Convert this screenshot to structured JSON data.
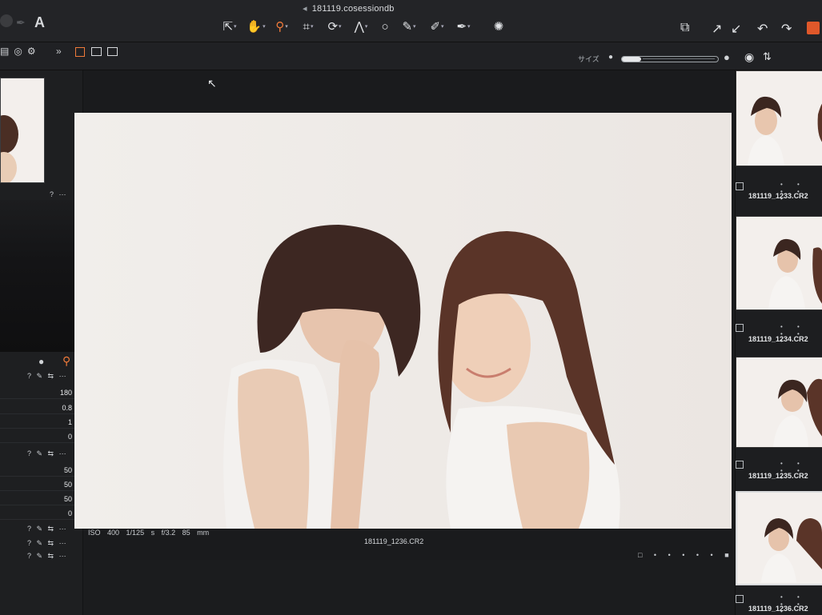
{
  "window": {
    "title": "181119.cosessiondb"
  },
  "toolbar": {
    "tools": [
      {
        "icon": "select-arrow-icon",
        "glyph": "⇱"
      },
      {
        "icon": "pan-hand-icon",
        "glyph": "✋"
      },
      {
        "icon": "zoom-icon",
        "glyph": "⚲",
        "active": true
      },
      {
        "icon": "crop-icon",
        "glyph": "⌗"
      },
      {
        "icon": "rotate-icon",
        "glyph": "⟳"
      },
      {
        "icon": "keystone-icon",
        "glyph": "⋀"
      },
      {
        "icon": "spot-circle-icon",
        "glyph": "○"
      },
      {
        "icon": "brush-icon",
        "glyph": "✎"
      },
      {
        "icon": "eraser-icon",
        "glyph": "✐"
      },
      {
        "icon": "picker-icon",
        "glyph": "✒"
      },
      {
        "icon": "spinner-icon",
        "glyph": "✺"
      }
    ],
    "right_tools": [
      "window-stack-icon",
      "export-arrow-icon",
      "import-arrow-icon",
      "undo-icon",
      "redo-icon"
    ]
  },
  "left_header": {
    "app_letter": "A"
  },
  "browser": {
    "size_label": "サイズ",
    "zoom_slider_fraction": 0.18
  },
  "adjustments": {
    "group1": [
      "180",
      "0.8",
      "1",
      "0"
    ],
    "group2": [
      "50",
      "50",
      "50",
      "0"
    ]
  },
  "viewer": {
    "exif": {
      "iso": "ISO 400",
      "shutter": "1/125 s",
      "aperture": "f/3.2",
      "focal": "85 mm"
    },
    "filename": "181119_1236.CR2"
  },
  "filmstrip": [
    {
      "label": "181119_1233.CR2"
    },
    {
      "label": "181119_1234.CR2"
    },
    {
      "label": "181119_1235.CR2"
    },
    {
      "label": "181119_1236.CR2",
      "selected": true
    }
  ],
  "colors": {
    "accent": "#f07a3a",
    "background": "#1b1c1e",
    "photo_background": "#efece9"
  }
}
